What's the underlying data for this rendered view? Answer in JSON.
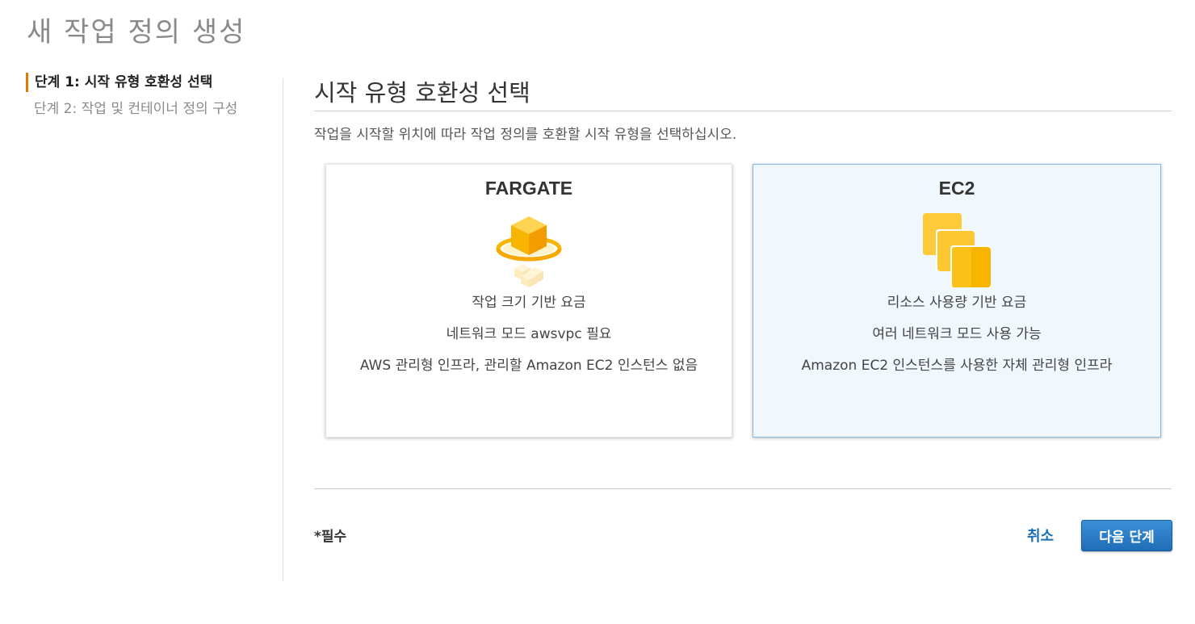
{
  "page": {
    "title": "새 작업 정의 생성"
  },
  "steps": [
    {
      "label": "단계 1: 시작 유형 호환성 선택",
      "active": true
    },
    {
      "label": "단계 2: 작업 및 컨테이너 정의 구성",
      "active": false
    }
  ],
  "section": {
    "title": "시작 유형 호환성 선택",
    "description": "작업을 시작할 위치에 따라 작업 정의를 호환할 시작 유형을 선택하십시오."
  },
  "cards": [
    {
      "title": "FARGATE",
      "icon": "fargate-icon",
      "lines": [
        "작업 크기 기반 요금",
        "네트워크 모드 awsvpc 필요",
        "AWS 관리형 인프라, 관리할 Amazon EC2 인스턴스 없음"
      ],
      "selected": false
    },
    {
      "title": "EC2",
      "icon": "ec2-instances-icon",
      "lines": [
        "리소스 사용량 기반 요금",
        "여러 네트워크 모드 사용 가능",
        "Amazon EC2 인스턴스를 사용한 자체 관리형 인프라"
      ],
      "selected": true
    }
  ],
  "footer": {
    "required_note": "*필수",
    "cancel_label": "취소",
    "next_label": "다음 단계"
  },
  "colors": {
    "accent_orange": "#e07b00",
    "primary_blue": "#1f6db6",
    "selected_card_bg": "#f0f7fd",
    "selected_card_border": "#88b9e0"
  }
}
